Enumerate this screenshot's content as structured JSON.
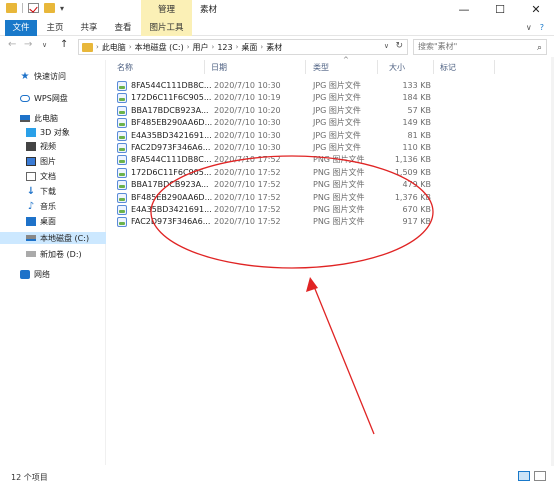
{
  "window": {
    "title": "素材",
    "context_tab": "管理",
    "controls": {
      "minimize": "—",
      "maximize": "☐",
      "close": "✕"
    }
  },
  "ribbon": {
    "tabs": [
      "文件",
      "主页",
      "共享",
      "查看",
      "图片工具"
    ],
    "right_caret": "∨",
    "help": "?"
  },
  "address": {
    "back": "←",
    "forward": "→",
    "recent": "∨",
    "up": "↑",
    "crumbs": [
      "此电脑",
      "本地磁盘 (C:)",
      "用户",
      "123",
      "桌面",
      "素材"
    ],
    "crumb_sep": "›",
    "dropdown": "∨",
    "refresh": "↻",
    "search_placeholder": "搜索\"素材\"",
    "search_icon": "⌕"
  },
  "sidebar": {
    "items": [
      {
        "label": "快速访问",
        "icon": "star-icon"
      },
      {
        "label": "WPS网盘",
        "icon": "cloud-icon"
      },
      {
        "label": "此电脑",
        "icon": "computer-icon"
      },
      {
        "label": "3D 对象",
        "icon": "3d-objects-icon"
      },
      {
        "label": "视频",
        "icon": "video-icon"
      },
      {
        "label": "图片",
        "icon": "pictures-icon"
      },
      {
        "label": "文档",
        "icon": "documents-icon"
      },
      {
        "label": "下载",
        "icon": "download-icon"
      },
      {
        "label": "音乐",
        "icon": "music-icon"
      },
      {
        "label": "桌面",
        "icon": "desktop-icon"
      },
      {
        "label": "本地磁盘 (C:)",
        "icon": "drive-icon"
      },
      {
        "label": "新加卷 (D:)",
        "icon": "drive-icon"
      },
      {
        "label": "网络",
        "icon": "network-icon"
      }
    ],
    "selected": "本地磁盘 (C:)"
  },
  "columns": {
    "name": "名称",
    "date": "日期",
    "type": "类型",
    "size": "大小",
    "tags": "标记",
    "sort_caret": "^"
  },
  "files": [
    {
      "name": "8FA544C111DB8C...",
      "date": "2020/7/10 10:30",
      "type": "JPG 图片文件",
      "size": "133 KB"
    },
    {
      "name": "172D6C11F6C905...",
      "date": "2020/7/10 10:19",
      "type": "JPG 图片文件",
      "size": "184 KB"
    },
    {
      "name": "BBA17BDCB923A...",
      "date": "2020/7/10 10:20",
      "type": "JPG 图片文件",
      "size": "57 KB"
    },
    {
      "name": "BF485EB290AA6D...",
      "date": "2020/7/10 10:30",
      "type": "JPG 图片文件",
      "size": "149 KB"
    },
    {
      "name": "E4A35BD3421691...",
      "date": "2020/7/10 10:30",
      "type": "JPG 图片文件",
      "size": "81 KB"
    },
    {
      "name": "FAC2D973F346A6...",
      "date": "2020/7/10 10:30",
      "type": "JPG 图片文件",
      "size": "110 KB"
    },
    {
      "name": "8FA544C111DB8C...",
      "date": "2020/7/10 17:52",
      "type": "PNG 图片文件",
      "size": "1,136 KB"
    },
    {
      "name": "172D6C11F6C905...",
      "date": "2020/7/10 17:52",
      "type": "PNG 图片文件",
      "size": "1,509 KB"
    },
    {
      "name": "BBA17BDCB923A...",
      "date": "2020/7/10 17:52",
      "type": "PNG 图片文件",
      "size": "479 KB"
    },
    {
      "name": "BF485EB290AA6D...",
      "date": "2020/7/10 17:52",
      "type": "PNG 图片文件",
      "size": "1,376 KB"
    },
    {
      "name": "E4A35BD3421691...",
      "date": "2020/7/10 17:52",
      "type": "PNG 图片文件",
      "size": "670 KB"
    },
    {
      "name": "FAC2D973F346A6...",
      "date": "2020/7/10 17:52",
      "type": "PNG 图片文件",
      "size": "917 KB"
    }
  ],
  "status": {
    "count": "12 个项目"
  },
  "colors": {
    "accent": "#1979ca",
    "context": "#fbf0b6",
    "annotation": "#e02424",
    "selected": "#cce8ff"
  }
}
